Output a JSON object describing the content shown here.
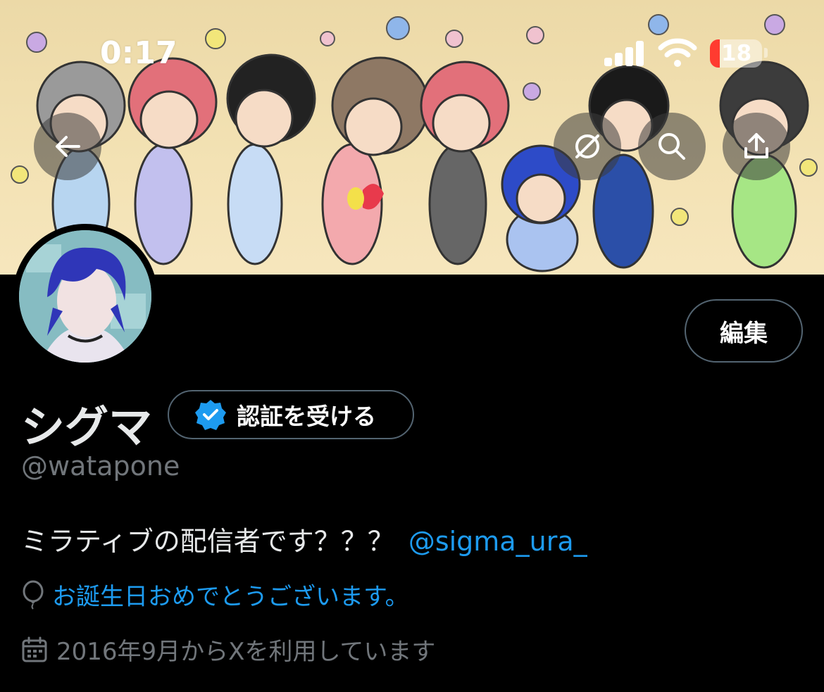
{
  "status_bar": {
    "time": "0:17",
    "battery": "18"
  },
  "header": {
    "back_icon": "arrow-left-icon",
    "grok_icon": "grok-icon",
    "search_icon": "search-icon",
    "share_icon": "share-icon"
  },
  "profile": {
    "edit_label": "編集",
    "name": "シグマ",
    "verify_label": "認証を受ける",
    "handle": "@watapone",
    "bio": "ミラティブの配信者です？？？",
    "bio_mention": "@sigma_ura_",
    "birthday": "お誕生日おめでとうございます。",
    "joined": "2016年9月からXを利用しています"
  },
  "colors": {
    "accent": "#1d9bf0",
    "muted": "#71767b",
    "border": "#536471",
    "battery_low": "#ff3b30"
  }
}
